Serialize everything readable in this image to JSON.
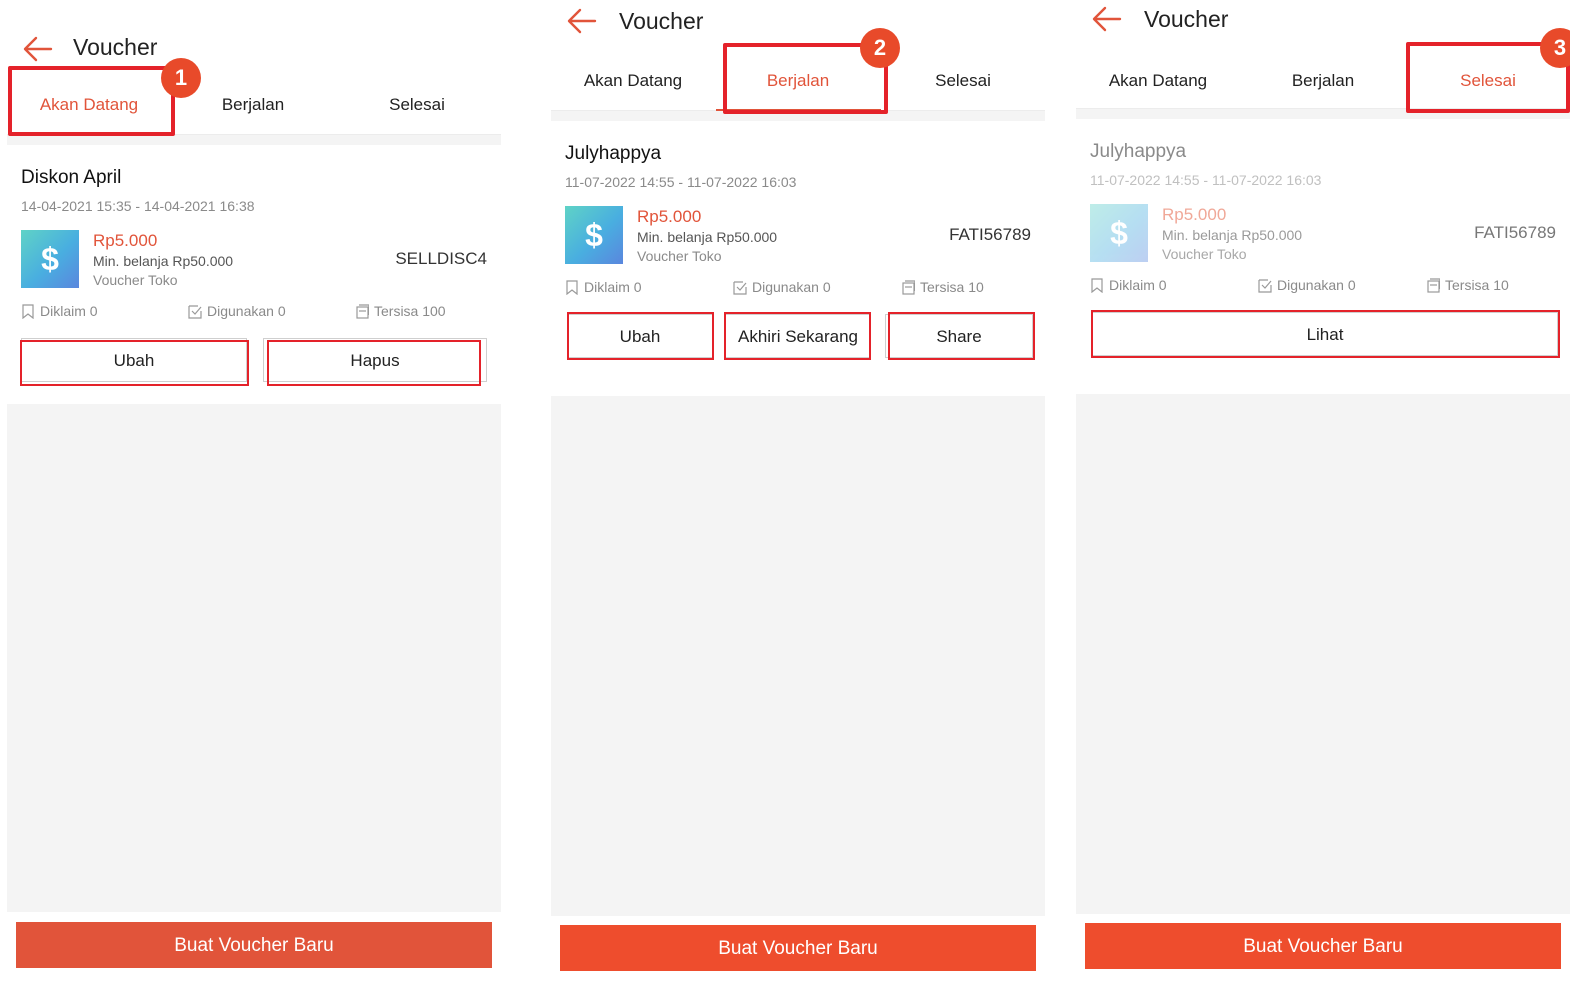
{
  "header_title": "Voucher",
  "tabs": [
    "Akan Datang",
    "Berjalan",
    "Selesai"
  ],
  "accent_color": "#e1543a",
  "panels": [
    {
      "step": "1",
      "active_tab": "Akan Datang",
      "voucher": {
        "name": "Diskon April",
        "date_range": "14-04-2021 15:35 - 14-04-2021 16:38",
        "amount": "Rp5.000",
        "min_spend": "Min. belanja Rp50.000",
        "type": "Voucher Toko",
        "code": "SELLDISC4"
      },
      "stats": {
        "claimed": "Diklaim 0",
        "used": "Digunakan 0",
        "remaining": "Tersisa 100"
      },
      "actions": [
        "Ubah",
        "Hapus"
      ],
      "footer_button": "Buat Voucher Baru"
    },
    {
      "step": "2",
      "active_tab": "Berjalan",
      "voucher": {
        "name": "Julyhappya",
        "date_range": "11-07-2022 14:55 - 11-07-2022 16:03",
        "amount": "Rp5.000",
        "min_spend": "Min. belanja Rp50.000",
        "type": "Voucher Toko",
        "code": "FATI56789"
      },
      "stats": {
        "claimed": "Diklaim 0",
        "used": "Digunakan 0",
        "remaining": "Tersisa 10"
      },
      "actions": [
        "Ubah",
        "Akhiri Sekarang",
        "Share"
      ],
      "footer_button": "Buat Voucher Baru"
    },
    {
      "step": "3",
      "active_tab": "Selesai",
      "voucher": {
        "name": "Julyhappya",
        "date_range": "11-07-2022 14:55 - 11-07-2022 16:03",
        "amount": "Rp5.000",
        "min_spend": "Min. belanja Rp50.000",
        "type": "Voucher Toko",
        "code": "FATI56789"
      },
      "stats": {
        "claimed": "Diklaim 0",
        "used": "Digunakan 0",
        "remaining": "Tersisa 10"
      },
      "actions": [
        "Lihat"
      ],
      "footer_button": "Buat Voucher Baru"
    }
  ]
}
